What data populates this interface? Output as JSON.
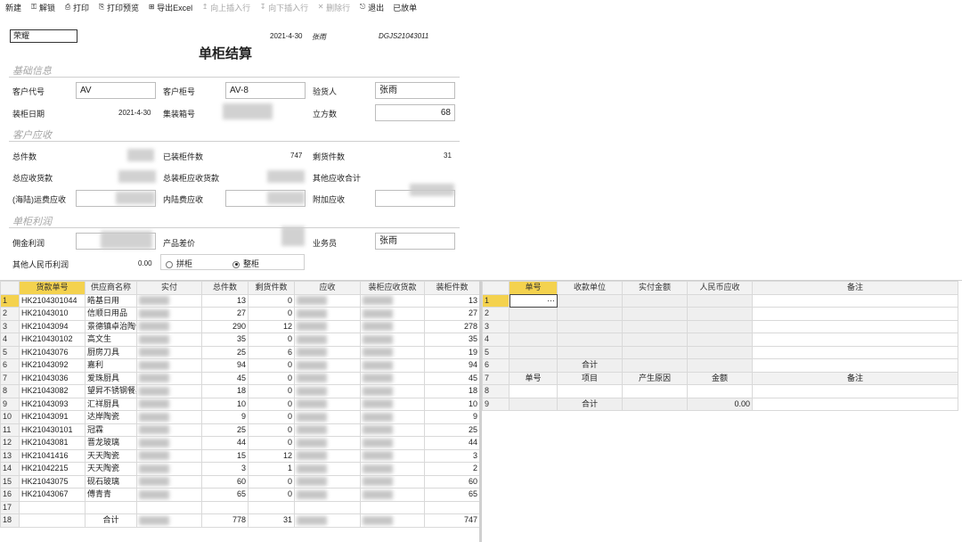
{
  "toolbar": {
    "items": [
      {
        "label": "新建",
        "icon": "",
        "disabled": false
      },
      {
        "label": "解锁",
        "icon": "⚿",
        "disabled": false
      },
      {
        "label": "打印",
        "icon": "⎙",
        "disabled": false
      },
      {
        "label": "打印预览",
        "icon": "⎘",
        "disabled": false
      },
      {
        "label": "导出Excel",
        "icon": "⊞",
        "disabled": false
      },
      {
        "label": "向上插入行",
        "icon": "↥",
        "disabled": true
      },
      {
        "label": "向下插入行",
        "icon": "↧",
        "disabled": true
      },
      {
        "label": "删除行",
        "icon": "✕",
        "disabled": true
      },
      {
        "label": "退出",
        "icon": "⎋",
        "disabled": false
      },
      {
        "label": "已放单",
        "icon": "",
        "disabled": false
      }
    ]
  },
  "header": {
    "combo_value": "荣耀",
    "date": "2021-4-30",
    "operator": "张雨",
    "doc_no": "DGJS21043011",
    "title": "单柜结算"
  },
  "sections": {
    "basic": "基础信息",
    "receivable": "客户应收",
    "profit": "单柜利润"
  },
  "basic": {
    "customer_code_label": "客户代号",
    "customer_code": "AV",
    "container_no_label": "客户柜号",
    "container_no": "AV-8",
    "inspector_label": "验货人",
    "inspector": "张雨",
    "load_date_label": "装柜日期",
    "load_date": "2021-4-30",
    "box_no_label": "集装箱号",
    "cbm_label": "立方数",
    "cbm": "68"
  },
  "receivable": {
    "total_pcs_label": "总件数",
    "loaded_pcs_label": "已装柜件数",
    "loaded_pcs": "747",
    "remain_pcs_label": "剩货件数",
    "remain_pcs": "31",
    "total_recv_label": "总应收货款",
    "loaded_recv_label": "总装柜应收货款",
    "other_recv_label": "其他应收合计",
    "sea_freight_label": "(海陆)运费应收",
    "inland_label": "内陆费应收",
    "extra_label": "附加应收"
  },
  "profit": {
    "commission_label": "佣金利润",
    "price_diff_label": "产品差价",
    "salesman_label": "业务员",
    "salesman": "张雨",
    "other_rmb_label": "其他人民币利润",
    "other_rmb": "0.00",
    "radio_lcl": "拼柜",
    "radio_fcl": "整柜"
  },
  "left_grid": {
    "columns": [
      "货款单号",
      "供应商名称",
      "实付",
      "总件数",
      "剩货件数",
      "应收",
      "装柜应收货款",
      "装柜件数"
    ],
    "rows": [
      {
        "n": "1",
        "order": "HK2104301044",
        "supplier": "皓基日用",
        "total": "13",
        "remain": "0",
        "loaded": "13"
      },
      {
        "n": "2",
        "order": "HK21043010",
        "supplier": "信顺日用品",
        "total": "27",
        "remain": "0",
        "loaded": "27"
      },
      {
        "n": "3",
        "order": "HK21043094",
        "supplier": "景德镇卓治陶瓷",
        "total": "290",
        "remain": "12",
        "loaded": "278"
      },
      {
        "n": "4",
        "order": "HK210430102",
        "supplier": "高文生",
        "total": "35",
        "remain": "0",
        "loaded": "35"
      },
      {
        "n": "5",
        "order": "HK21043076",
        "supplier": "厨房刀具",
        "total": "25",
        "remain": "6",
        "loaded": "19"
      },
      {
        "n": "6",
        "order": "HK21043092",
        "supplier": "嘉利",
        "total": "94",
        "remain": "0",
        "loaded": "94"
      },
      {
        "n": "7",
        "order": "HK21043036",
        "supplier": "爱珠厨具",
        "total": "45",
        "remain": "0",
        "loaded": "45"
      },
      {
        "n": "8",
        "order": "HK21043082",
        "supplier": "望昇不锈钢餐具",
        "total": "18",
        "remain": "0",
        "loaded": "18"
      },
      {
        "n": "9",
        "order": "HK21043093",
        "supplier": "汇祥厨具",
        "total": "10",
        "remain": "0",
        "loaded": "10"
      },
      {
        "n": "10",
        "order": "HK21043091",
        "supplier": "达岸陶瓷",
        "total": "9",
        "remain": "0",
        "loaded": "9"
      },
      {
        "n": "11",
        "order": "HK210430101",
        "supplier": "冠霖",
        "total": "25",
        "remain": "0",
        "loaded": "25"
      },
      {
        "n": "12",
        "order": "HK21043081",
        "supplier": "晋龙玻璃",
        "total": "44",
        "remain": "0",
        "loaded": "44"
      },
      {
        "n": "13",
        "order": "HK21041416",
        "supplier": "天天陶瓷",
        "total": "15",
        "remain": "12",
        "loaded": "3"
      },
      {
        "n": "14",
        "order": "HK21042215",
        "supplier": "天天陶瓷",
        "total": "3",
        "remain": "1",
        "loaded": "2"
      },
      {
        "n": "15",
        "order": "HK21043075",
        "supplier": "砚石玻璃",
        "total": "60",
        "remain": "0",
        "loaded": "60"
      },
      {
        "n": "16",
        "order": "HK21043067",
        "supplier": "傅青青",
        "total": "65",
        "remain": "0",
        "loaded": "65"
      },
      {
        "n": "17",
        "order": "",
        "supplier": "",
        "total": "",
        "remain": "",
        "loaded": ""
      },
      {
        "n": "18",
        "order": "",
        "supplier": "合计",
        "total": "778",
        "remain": "31",
        "loaded": "747"
      }
    ]
  },
  "right_grid": {
    "columns": [
      "单号",
      "收款单位",
      "实付金额",
      "人民币应收",
      "备注"
    ],
    "row6_label": "合计",
    "sub_columns": [
      "单号",
      "项目",
      "产生原因",
      "金额",
      "备注"
    ],
    "row9_label": "合计",
    "row9_amount": "0.00",
    "ellipsis": "···",
    "row_numbers": [
      "1",
      "2",
      "3",
      "4",
      "5",
      "6",
      "7",
      "8",
      "9"
    ]
  },
  "colors": {
    "accent_yellow": "#f4d24e",
    "section_gray": "#a6a6a6"
  }
}
